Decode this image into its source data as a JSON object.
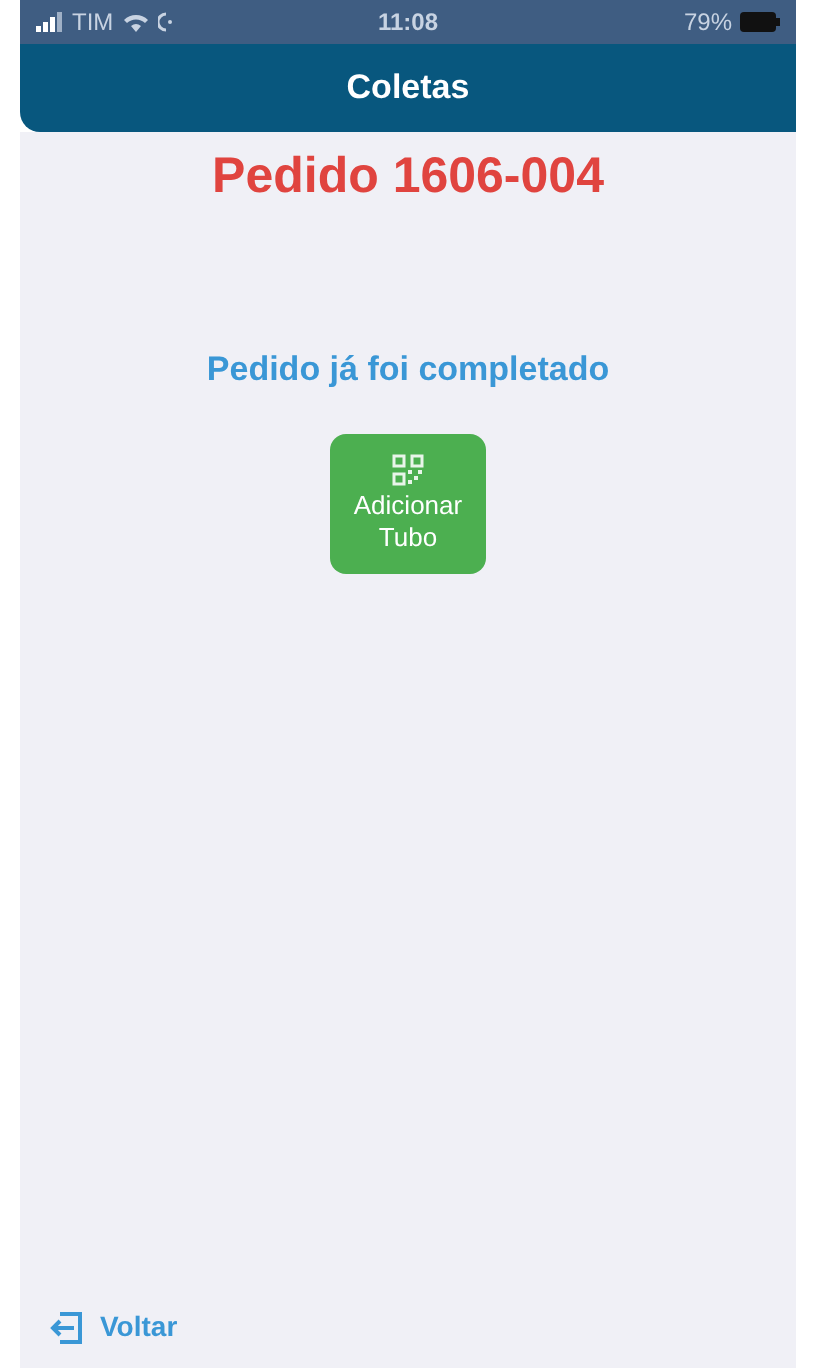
{
  "status_bar": {
    "carrier": "TIM",
    "time": "11:08",
    "battery": "79%"
  },
  "header": {
    "title": "Coletas"
  },
  "order_title": "Pedido 1606-004",
  "message": "Pedido já foi completado",
  "add_button": {
    "label": "Adicionar Tubo"
  },
  "back_link": {
    "label": "Voltar"
  }
}
